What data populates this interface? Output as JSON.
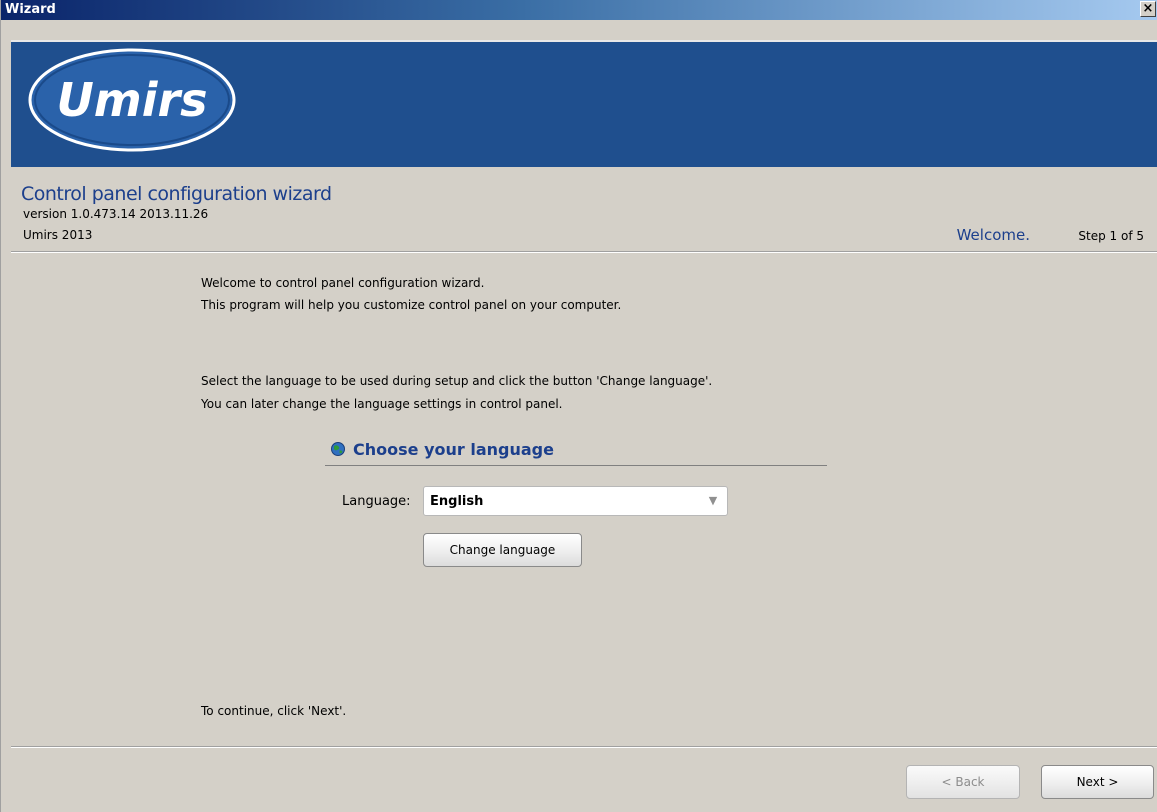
{
  "window": {
    "title": "Wizard",
    "close_label": "×"
  },
  "banner": {
    "logo_text": "Umirs",
    "background_color": "#1f4f8e"
  },
  "header": {
    "wizard_title": "Control panel configuration wizard",
    "version": "version 1.0.473.14 2013.11.26",
    "company": "Umirs 2013",
    "step_name": "Welcome.",
    "step_count": "Step 1 of 5"
  },
  "body": {
    "intro_line1": "Welcome to control panel configuration wizard.",
    "intro_line2": "This program will help you customize control panel on your computer.",
    "lang_line1": "Select the language to be used during setup and click the button 'Change language'.",
    "lang_line2": "You can later change the language settings in control panel.",
    "section_title": "Choose your language",
    "section_icon": "globe-icon",
    "language_label": "Language:",
    "language_value": "English",
    "change_language_label": "Change language",
    "continue_text": "To continue, click 'Next'."
  },
  "footer": {
    "back_label": "< Back",
    "next_label": "Next >"
  }
}
